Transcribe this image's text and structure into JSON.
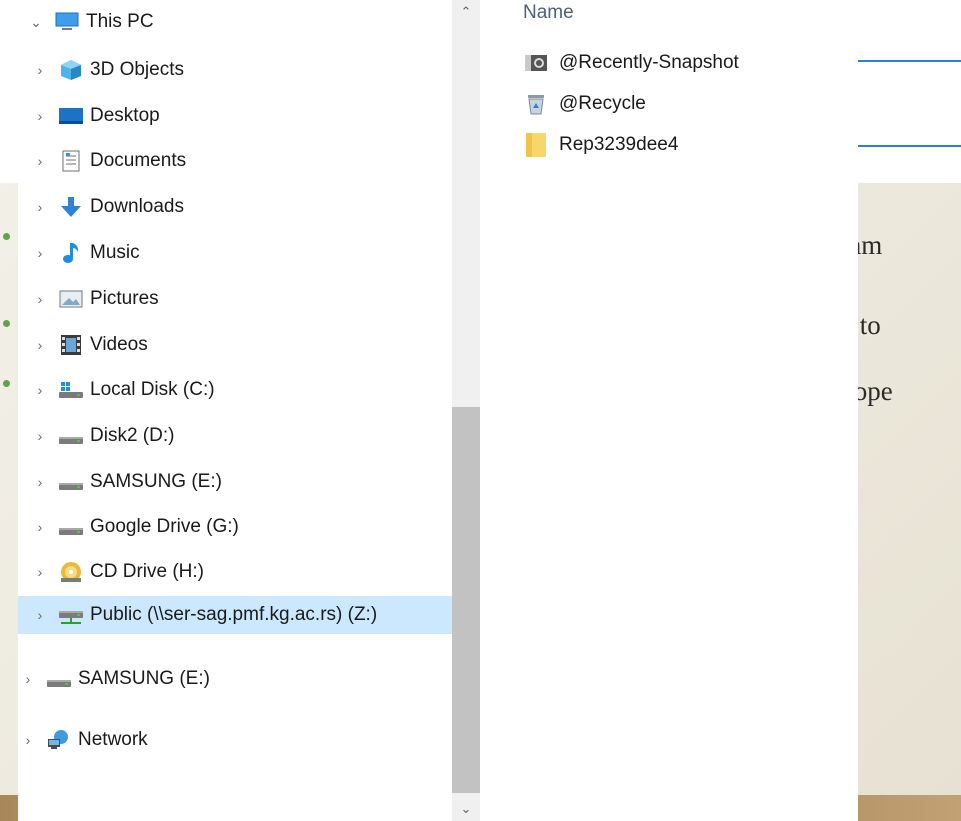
{
  "nav": {
    "items": [
      {
        "label": "This PC",
        "icon": "computer-icon",
        "expanded": true
      },
      {
        "label": "3D Objects",
        "icon": "cube-icon"
      },
      {
        "label": "Desktop",
        "icon": "desktop-icon"
      },
      {
        "label": "Documents",
        "icon": "document-icon"
      },
      {
        "label": "Downloads",
        "icon": "download-arrow-icon"
      },
      {
        "label": "Music",
        "icon": "music-note-icon"
      },
      {
        "label": "Pictures",
        "icon": "picture-icon"
      },
      {
        "label": "Videos",
        "icon": "film-icon"
      },
      {
        "label": "Local Disk (C:)",
        "icon": "windows-drive-icon"
      },
      {
        "label": "Disk2 (D:)",
        "icon": "drive-icon"
      },
      {
        "label": "SAMSUNG (E:)",
        "icon": "drive-icon"
      },
      {
        "label": "Google Drive (G:)",
        "icon": "drive-icon"
      },
      {
        "label": "CD Drive (H:)",
        "icon": "cd-drive-icon"
      },
      {
        "label": "Public (\\\\ser-sag.pmf.kg.ac.rs) (Z:)",
        "icon": "network-drive-icon",
        "selected": true
      },
      {
        "label": "SAMSUNG (E:)",
        "icon": "drive-icon"
      },
      {
        "label": "Network",
        "icon": "network-icon"
      }
    ]
  },
  "content": {
    "column_header": "Name",
    "files": [
      {
        "name": "@Recently-Snapshot",
        "icon": "snapshot-folder-icon"
      },
      {
        "name": "@Recycle",
        "icon": "recycle-bin-icon"
      },
      {
        "name": "Rep3239dee4",
        "icon": "folder-icon"
      }
    ]
  },
  "slide": {
    "lines": [
      "r nam",
      "ble to",
      "on ope"
    ]
  },
  "colors": {
    "selection": "#cce8ff",
    "accent_line": "#2f7fd1",
    "bullet": "#5fa34a",
    "header_text": "#4c607a"
  }
}
